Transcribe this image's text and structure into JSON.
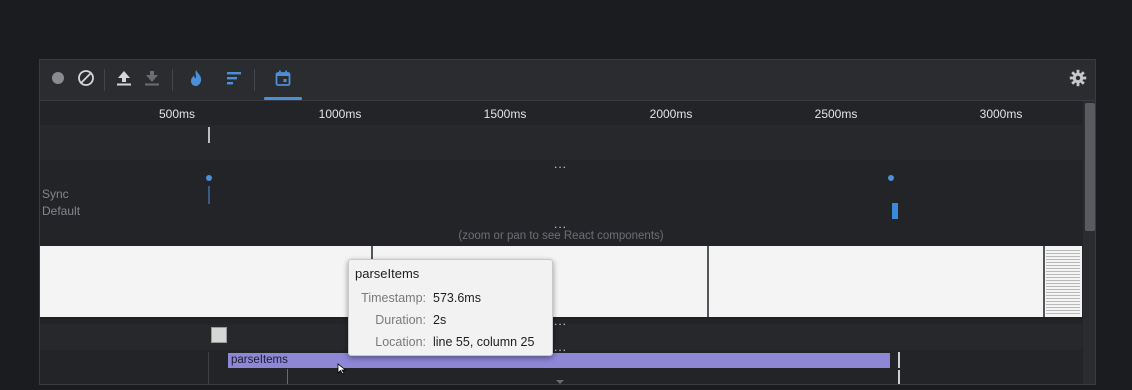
{
  "toolbar": {
    "buttons": [
      {
        "icon": "record-icon",
        "active": false
      },
      {
        "icon": "clear-icon",
        "active": false
      },
      {
        "icon": "upload-icon",
        "active": false
      },
      {
        "icon": "download-icon",
        "active": false
      },
      {
        "icon": "flame-icon",
        "active": false
      },
      {
        "icon": "ranked-icon",
        "active": false
      },
      {
        "icon": "timeline-calendar-icon",
        "active": true
      },
      {
        "icon": "settings-gear-icon",
        "active": false
      }
    ],
    "accent_color": "#4a8fd8"
  },
  "ruler": {
    "ticks": [
      "500ms",
      "1000ms",
      "1500ms",
      "2000ms",
      "2500ms",
      "3000ms"
    ]
  },
  "lanes": {
    "dots": "...",
    "sync_label": "Sync",
    "default_label": "Default",
    "components_hint": "(zoom or pan to see React components)"
  },
  "flame": {
    "bar_label": "parseItems",
    "bar_color": "#8d87d6"
  },
  "tooltip": {
    "title": "parseItems",
    "rows": [
      {
        "key": "Timestamp:",
        "value": "573.6ms"
      },
      {
        "key": "Duration:",
        "value": "2s"
      },
      {
        "key": "Location:",
        "value": "line 55, column 25"
      }
    ]
  }
}
